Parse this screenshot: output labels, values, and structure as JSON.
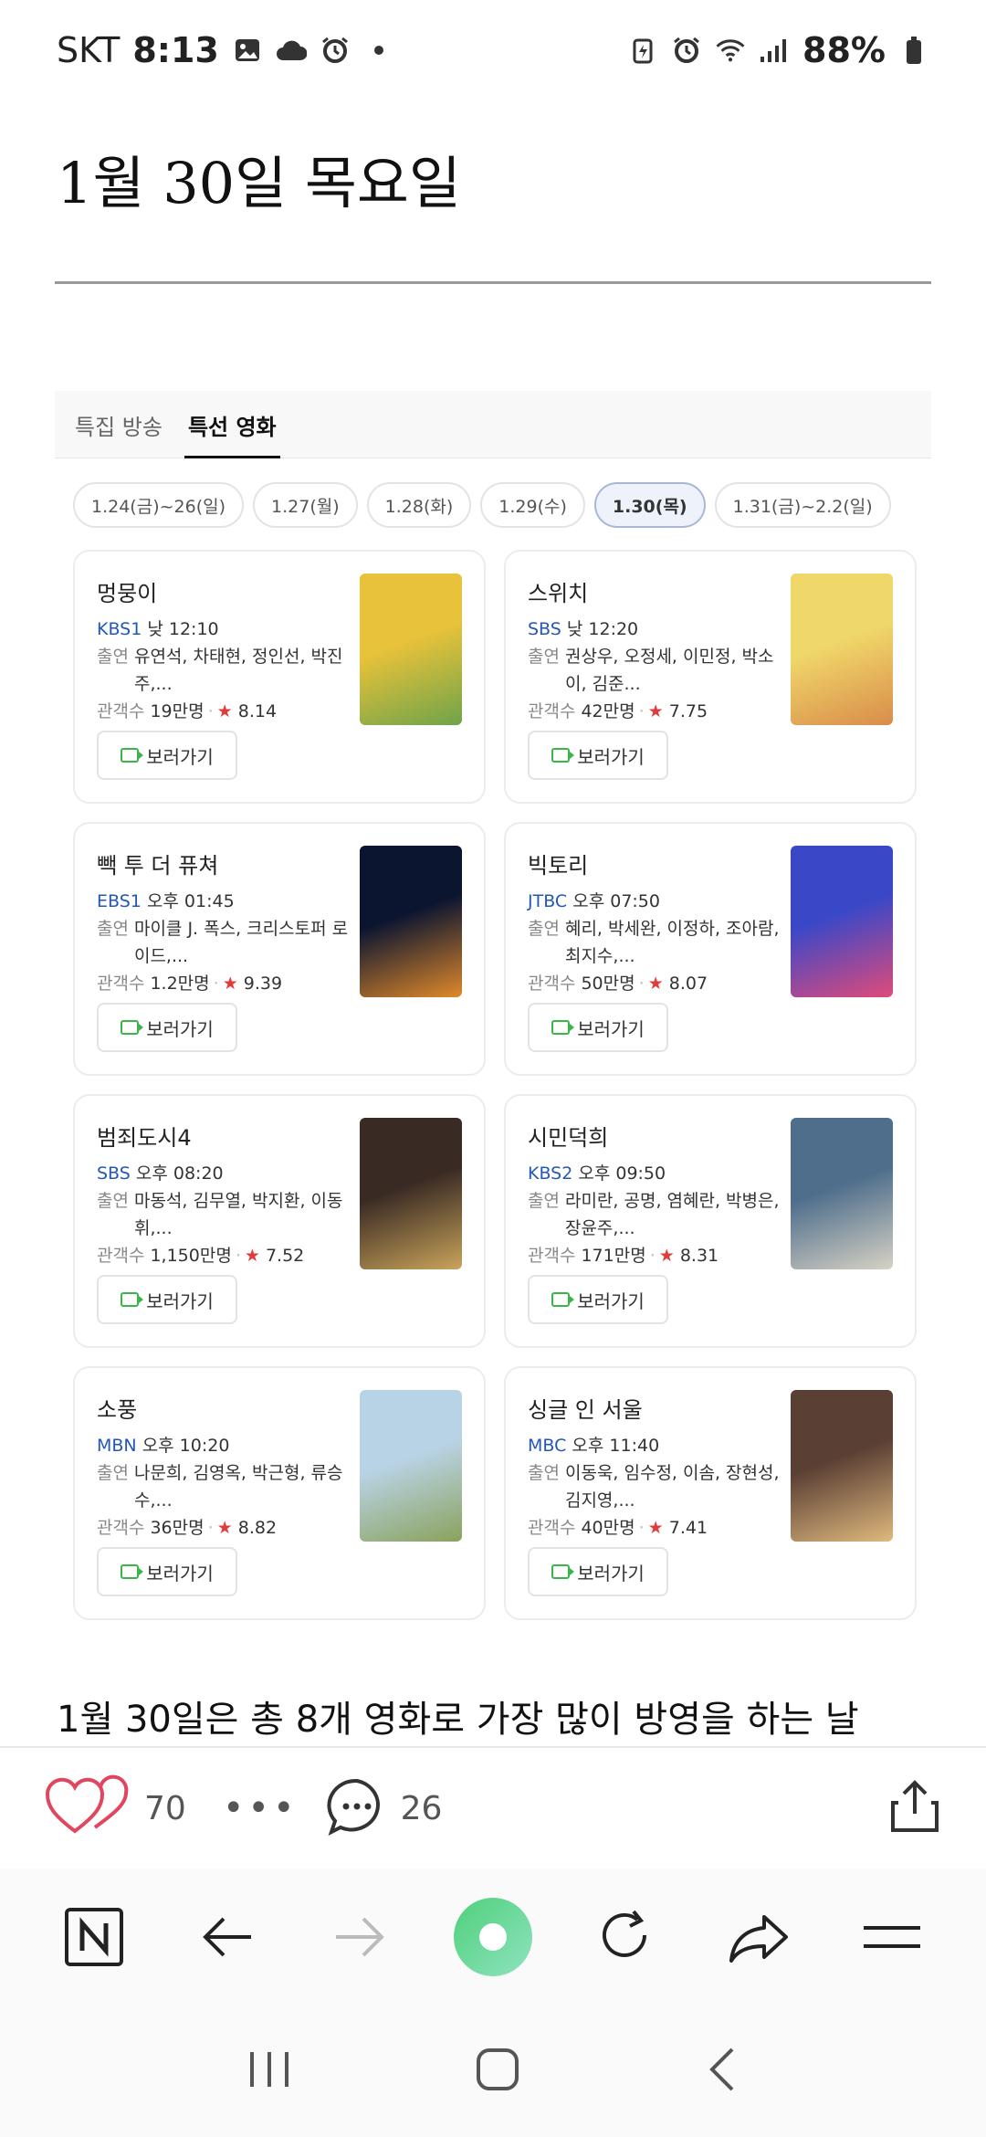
{
  "status_bar": {
    "carrier": "SKT",
    "time": "8:13",
    "battery": "88%"
  },
  "post": {
    "title": "1월 30일 목요일",
    "body_text": "1월 30일은 총 8개 영화로 가장 많이 방영을 하는 날"
  },
  "widget": {
    "tabs": [
      {
        "label": "특집 방송",
        "active": false
      },
      {
        "label": "특선 영화",
        "active": true
      }
    ],
    "dates": [
      {
        "label": "1.24(금)~26(일)",
        "active": false
      },
      {
        "label": "1.27(월)",
        "active": false
      },
      {
        "label": "1.28(화)",
        "active": false
      },
      {
        "label": "1.29(수)",
        "active": false
      },
      {
        "label": "1.30(목)",
        "active": true
      },
      {
        "label": "1.31(금)~2.2(일)",
        "active": false
      }
    ],
    "cast_label": "출연",
    "audience_label": "관객수",
    "watch_label": "보러가기",
    "star_glyph": "★",
    "movies": [
      {
        "title": "멍뭉이",
        "channel": "KBS1",
        "time": "낮 12:10",
        "cast": "유연석, 차태현, 정인선, 박진주,...",
        "audience": "19만명",
        "rating": "8.14",
        "poster_colors": [
          "#e8c23a",
          "#6fa34a"
        ]
      },
      {
        "title": "스위치",
        "channel": "SBS",
        "time": "낮 12:20",
        "cast": "권상우, 오정세, 이민정, 박소이, 김준...",
        "audience": "42만명",
        "rating": "7.75",
        "poster_colors": [
          "#f0d76a",
          "#d98c4a"
        ]
      },
      {
        "title": "빽 투 더 퓨쳐",
        "channel": "EBS1",
        "time": "오후 01:45",
        "cast": "마이클 J. 폭스, 크리스토퍼 로이드,...",
        "audience": "1.2만명",
        "rating": "9.39",
        "poster_colors": [
          "#0c1530",
          "#e0892a"
        ]
      },
      {
        "title": "빅토리",
        "channel": "JTBC",
        "time": "오후 07:50",
        "cast": "혜리, 박세완, 이정하, 조아람, 최지수,...",
        "audience": "50만명",
        "rating": "8.07",
        "poster_colors": [
          "#3a48c8",
          "#e04a7a"
        ]
      },
      {
        "title": "범죄도시4",
        "channel": "SBS",
        "time": "오후 08:20",
        "cast": "마동석, 김무열, 박지환, 이동휘,...",
        "audience": "1,150만명",
        "rating": "7.52",
        "poster_colors": [
          "#3a2a24",
          "#c9a45a"
        ]
      },
      {
        "title": "시민덕희",
        "channel": "KBS2",
        "time": "오후 09:50",
        "cast": "라미란, 공명, 염혜란, 박병은, 장윤주,...",
        "audience": "171만명",
        "rating": "8.31",
        "poster_colors": [
          "#4e6e8c",
          "#d7d2c4"
        ]
      },
      {
        "title": "소풍",
        "channel": "MBN",
        "time": "오후 10:20",
        "cast": "나문희, 김영옥, 박근형, 류승수,...",
        "audience": "36만명",
        "rating": "8.82",
        "poster_colors": [
          "#b9d3e6",
          "#8aa25c"
        ]
      },
      {
        "title": "싱글 인 서울",
        "channel": "MBC",
        "time": "오후 11:40",
        "cast": "이동욱, 임수정, 이솜, 장현성, 김지영,...",
        "audience": "40만명",
        "rating": "7.41",
        "poster_colors": [
          "#5a3f34",
          "#e0b97e"
        ]
      }
    ]
  },
  "reactions": {
    "likes": "70",
    "comments": "26"
  },
  "colors": {
    "accent_like": "#e0475f",
    "channel_blue": "#2357b8",
    "star_red": "#e23b3b",
    "nav_green": "#5fd38a"
  }
}
